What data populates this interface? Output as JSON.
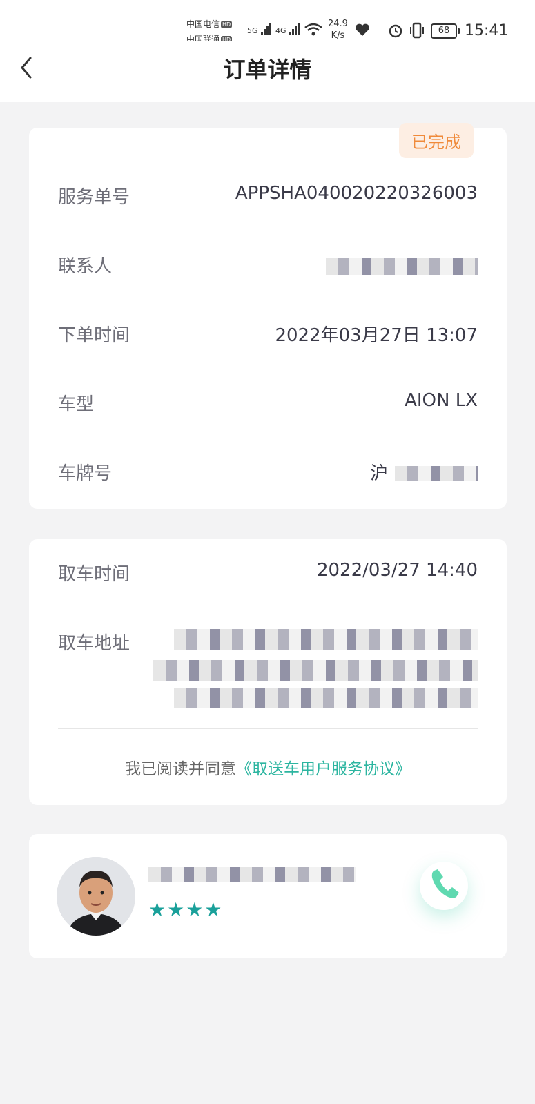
{
  "status_bar": {
    "carrier1": "中国电信",
    "carrier2": "中国联通",
    "hd": "HD",
    "net_5g": "5G",
    "net_4g": "4G",
    "net_speed_value": "24.9",
    "net_speed_unit": "K/s",
    "battery": "68",
    "time": "15:41"
  },
  "header": {
    "title": "订单详情"
  },
  "order": {
    "status_badge": "已完成",
    "service_no_label": "服务单号",
    "service_no_value": "APPSHA040020220326003",
    "contact_label": "联系人",
    "order_time_label": "下单时间",
    "order_time_value": "2022年03月27日 13:07",
    "car_model_label": "车型",
    "car_model_value": "AION LX",
    "plate_label": "车牌号",
    "plate_prefix": "沪"
  },
  "pickup": {
    "time_label": "取车时间",
    "time_value": "2022/03/27 14:40",
    "address_label": "取车地址",
    "agree_text": "我已阅读并同意",
    "agree_link": "《取送车用户服务协议》"
  },
  "driver": {
    "stars": "★★★★",
    "rating": 4
  },
  "colors": {
    "accent": "#2cb5a0",
    "badge_bg": "#fdeee3",
    "badge_text": "#f08a3a",
    "star": "#1aa09a"
  }
}
